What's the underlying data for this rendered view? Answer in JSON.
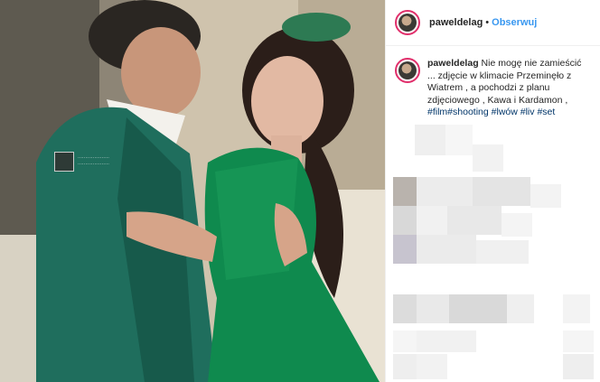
{
  "header": {
    "username": "paweldelag",
    "separator": "•",
    "follow_label": "Obserwuj"
  },
  "caption": {
    "username": "paweldelag",
    "text": "Nie mogę nie zamieścić ... zdjęcie w klimacie Przeminęło z Wiatrem , a pochodzi z planu zdjęciowego , Kawa i Kardamon ,",
    "hashtags": [
      "#film",
      "#shooting",
      "#lwów",
      "#liv",
      "#set"
    ]
  },
  "photo": {
    "description_icon": "post-photo"
  },
  "colors": {
    "link": "#3897f0",
    "hashtag": "#003569",
    "story_ring": "#e1306c",
    "dress_green": "#0f8a4e",
    "coat_green": "#1f6e5d"
  }
}
